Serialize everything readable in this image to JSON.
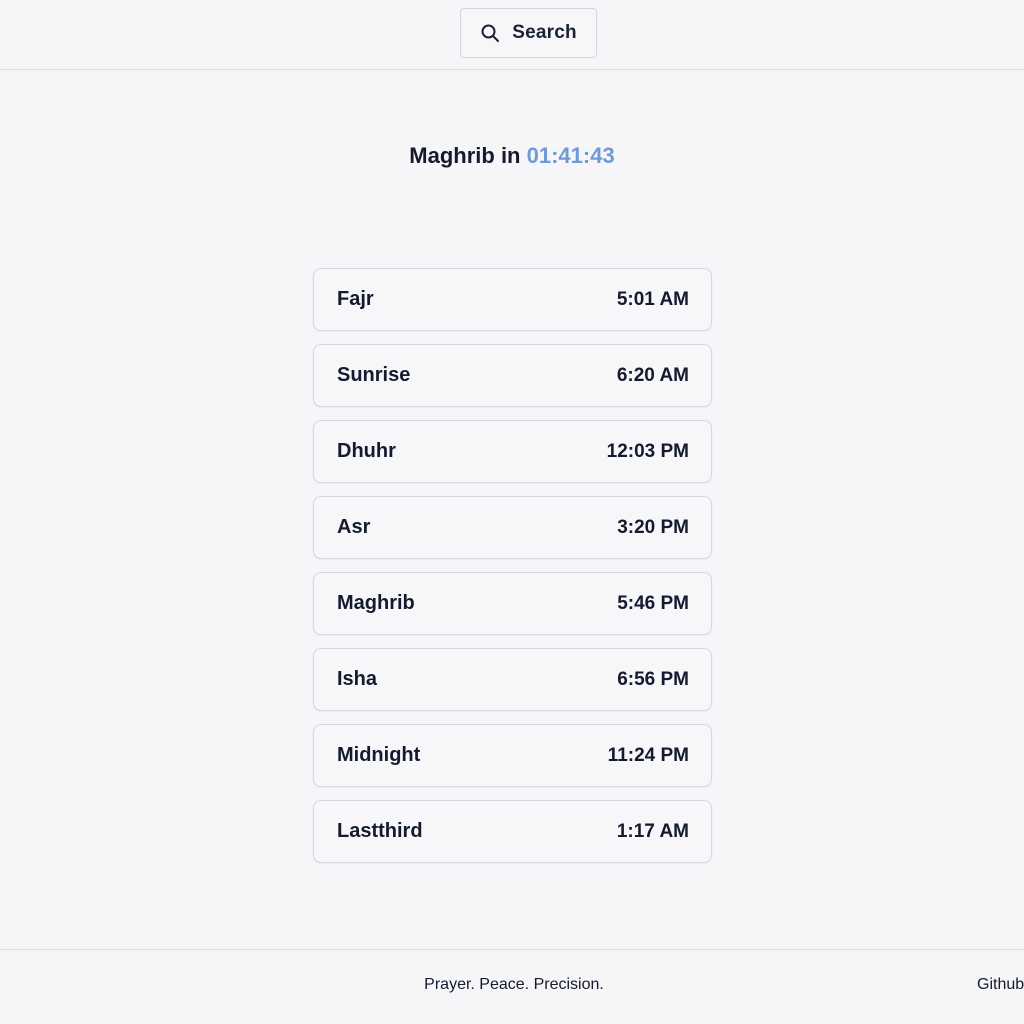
{
  "header": {
    "search_label": "Search",
    "search_icon": "search-icon"
  },
  "countdown": {
    "prefix": "Maghrib in",
    "time": "01:41:43",
    "accent_color": "#6f9ad2"
  },
  "prayers": [
    {
      "name": "Fajr",
      "time": "5:01 AM"
    },
    {
      "name": "Sunrise",
      "time": "6:20 AM"
    },
    {
      "name": "Dhuhr",
      "time": "12:03 PM"
    },
    {
      "name": "Asr",
      "time": "3:20 PM"
    },
    {
      "name": "Maghrib",
      "time": "5:46 PM"
    },
    {
      "name": "Isha",
      "time": "6:56 PM"
    },
    {
      "name": "Midnight",
      "time": "11:24 PM"
    },
    {
      "name": "Lastthird",
      "time": "1:17 AM"
    }
  ],
  "footer": {
    "tagline": "Prayer. Peace. Precision.",
    "github_label": "Github"
  }
}
